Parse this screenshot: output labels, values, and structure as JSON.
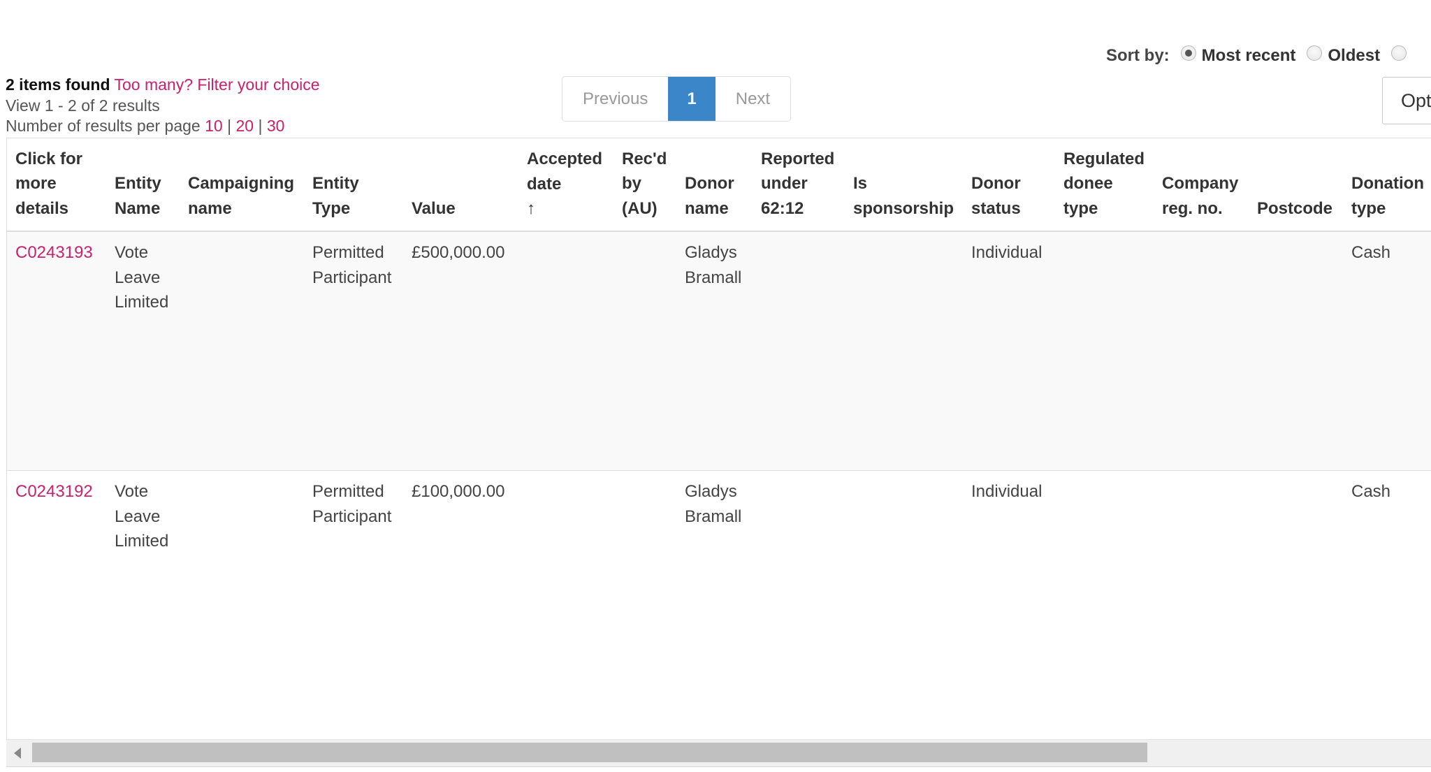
{
  "sort": {
    "label": "Sort by:",
    "options": [
      {
        "label": "Most recent",
        "checked": true
      },
      {
        "label": "Oldest",
        "checked": false
      },
      {
        "label": "",
        "checked": false
      }
    ]
  },
  "summary": {
    "found": "2 items found",
    "filter_link": "Too many? Filter your choice",
    "view_range": "View 1 - 2 of 2 results",
    "per_page_label": "Number of results per page",
    "per_page_options": [
      "10",
      "20",
      "30"
    ],
    "separator": "|"
  },
  "pagination": {
    "previous": "Previous",
    "current": "1",
    "next": "Next"
  },
  "options_button": "Opt",
  "table": {
    "columns": [
      "Click for\nmore\ndetails",
      "Entity\nName",
      "Campaigning\nname",
      "Entity\nType",
      "Value",
      "Accepted\ndate",
      "Rec'd\nby\n(AU)",
      "Donor\nname",
      "Reported\nunder\n62:12",
      "Is\nsponsorship",
      "Donor\nstatus",
      "Regulated\ndonee\ntype",
      "Company\nreg. no.",
      "Postcode",
      "Donation\ntype"
    ],
    "sort_indicator": "↑",
    "rows": [
      {
        "ref": "C0243193",
        "entity_name": "Vote\nLeave\nLimited",
        "campaigning_name": "",
        "entity_type": "Permitted\nParticipant",
        "value": "£500,000.00",
        "accepted_date": "",
        "recd_by_au": "",
        "donor_name": "Gladys\nBramall",
        "reported_under_6212": "",
        "is_sponsorship": "",
        "donor_status": "Individual",
        "regulated_donee_type": "",
        "company_reg_no": "",
        "postcode": "",
        "donation_type": "Cash"
      },
      {
        "ref": "C0243192",
        "entity_name": "Vote\nLeave\nLimited",
        "campaigning_name": "",
        "entity_type": "Permitted\nParticipant",
        "value": "£100,000.00",
        "accepted_date": "",
        "recd_by_au": "",
        "donor_name": "Gladys\nBramall",
        "reported_under_6212": "",
        "is_sponsorship": "",
        "donor_status": "Individual",
        "regulated_donee_type": "",
        "company_reg_no": "",
        "postcode": "",
        "donation_type": "Cash"
      }
    ]
  },
  "colors": {
    "link": "#c7226c",
    "pagination_active": "#3a86c8",
    "row_alt": "#f9f9f9"
  }
}
